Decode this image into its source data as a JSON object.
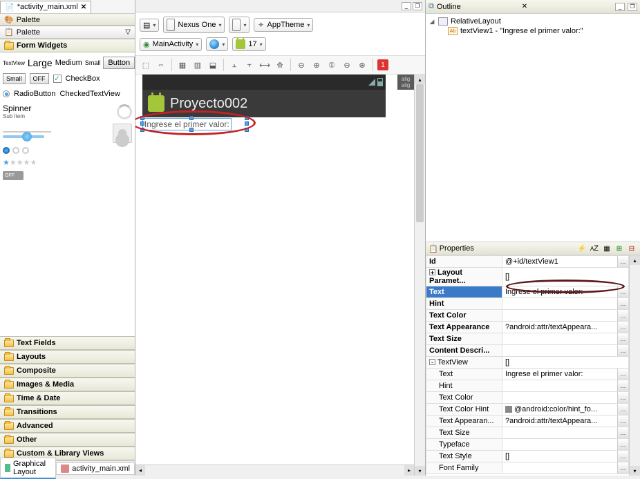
{
  "fileTab": {
    "name": "*activity_main.xml",
    "close": "✕"
  },
  "palette": {
    "title": "Palette",
    "subLabel": "Palette",
    "formWidgets": "Form Widgets",
    "textView": "TextView",
    "large": "Large",
    "medium": "Medium",
    "small": "Small",
    "button": "Button",
    "btnSmall": "Small",
    "btnOff": "OFF",
    "checkbox": "CheckBox",
    "radioButton": "RadioButton",
    "checkedTextView": "CheckedTextView",
    "spinner": "Spinner",
    "subItem": "Sub Item",
    "offToggle": "OFF",
    "categories": [
      "Text Fields",
      "Layouts",
      "Composite",
      "Images & Media",
      "Time & Date",
      "Transitions",
      "Advanced",
      "Other",
      "Custom & Library Views"
    ]
  },
  "bottomTabs": {
    "graphical": "Graphical Layout",
    "xml": "activity_main.xml"
  },
  "config": {
    "device": "Nexus One",
    "theme": "AppTheme",
    "activity": "MainActivity",
    "api": "17",
    "badge": "1",
    "alignSide": "alig\nalig"
  },
  "device": {
    "appTitle": "Proyecto002",
    "textViewText": "Ingrese el primer valor:"
  },
  "outline": {
    "title": "Outline",
    "root": "RelativeLayout",
    "child": "textView1 - \"Ingrese el primer valor:\""
  },
  "properties": {
    "title": "Properties",
    "rows": [
      {
        "k": "Id",
        "v": "@+id/textView1",
        "bold": true,
        "dots": true
      },
      {
        "k": "Layout Paramet...",
        "v": "[]",
        "bold": true,
        "exp": "+"
      },
      {
        "k": "Text",
        "v": "Ingrese el primer valor:",
        "bold": true,
        "hl": true,
        "dots": true
      },
      {
        "k": "Hint",
        "v": "",
        "bold": true,
        "dots": true
      },
      {
        "k": "Text Color",
        "v": "",
        "bold": true,
        "dots": true
      },
      {
        "k": "Text Appearance",
        "v": "?android:attr/textAppeara...",
        "bold": true,
        "dots": true
      },
      {
        "k": "Text Size",
        "v": "",
        "bold": true,
        "dots": true
      },
      {
        "k": "Content Descri...",
        "v": "",
        "bold": true,
        "dots": true
      },
      {
        "k": "TextView",
        "v": "[]",
        "bold": false,
        "exp": "-"
      },
      {
        "k": "Text",
        "v": "Ingrese el primer valor:",
        "sub": true,
        "dots": true
      },
      {
        "k": "Hint",
        "v": "",
        "sub": true,
        "dots": true
      },
      {
        "k": "Text Color",
        "v": "",
        "sub": true,
        "dots": true
      },
      {
        "k": "Text Color Hint",
        "v": "@android:color/hint_fo...",
        "sub": true,
        "dots": true,
        "swatch": true
      },
      {
        "k": "Text Appearan...",
        "v": "?android:attr/textAppeara...",
        "sub": true,
        "dots": true
      },
      {
        "k": "Text Size",
        "v": "",
        "sub": true,
        "dots": true
      },
      {
        "k": "Typeface",
        "v": "",
        "sub": true,
        "dots": true
      },
      {
        "k": "Text Style",
        "v": "[]",
        "sub": true,
        "dots": true
      },
      {
        "k": "Font Family",
        "v": "",
        "sub": true,
        "dots": true
      }
    ]
  }
}
